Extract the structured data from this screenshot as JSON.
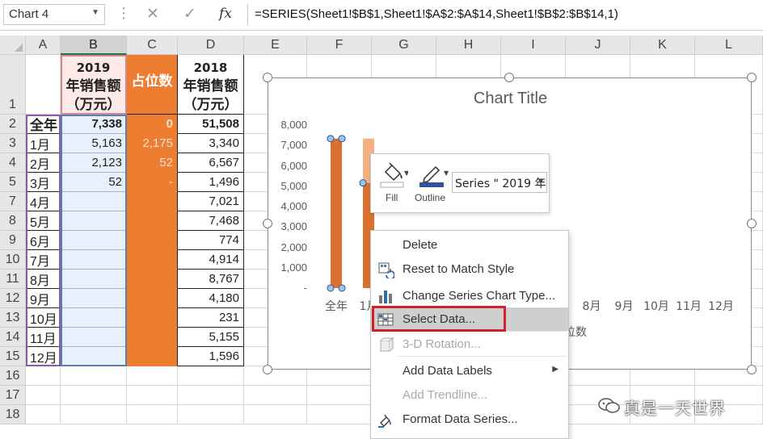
{
  "formula_bar": {
    "name_box": "Chart 4",
    "formula": "=SERIES(Sheet1!$B$1,Sheet1!$A$2:$A$14,Sheet1!$B$2:$B$14,1)",
    "cancel_icon": "close-icon",
    "enter_icon": "check-icon",
    "fx_label": "fx"
  },
  "columns": [
    "A",
    "B",
    "C",
    "D",
    "E",
    "F",
    "G",
    "H",
    "I",
    "J",
    "K",
    "L",
    "M"
  ],
  "rows": [
    "1",
    "2",
    "3",
    "4",
    "5",
    "7",
    "8",
    "9",
    "10",
    "11",
    "12",
    "13",
    "14",
    "15",
    "16",
    "17",
    "18"
  ],
  "table": {
    "headers": {
      "B": [
        "2019",
        "年销售额",
        "（万元）"
      ],
      "C": [
        "占位数"
      ],
      "D": [
        "2018",
        "年销售额",
        "（万元）"
      ]
    },
    "data_rows": [
      {
        "A": "全年",
        "B": "7,338",
        "C": "0",
        "D": "51,508"
      },
      {
        "A": "1月",
        "B": "5,163",
        "C": "2,175",
        "D": "3,340"
      },
      {
        "A": "2月",
        "B": "2,123",
        "C": "52",
        "D": "6,567"
      },
      {
        "A": "3月",
        "B": "52",
        "C": "-",
        "D": "1,496"
      },
      {
        "A": "4月",
        "B": "",
        "C": "",
        "D": "7,021"
      },
      {
        "A": "5月",
        "B": "",
        "C": "",
        "D": "7,468"
      },
      {
        "A": "6月",
        "B": "",
        "C": "",
        "D": "774"
      },
      {
        "A": "7月",
        "B": "",
        "C": "",
        "D": "4,914"
      },
      {
        "A": "8月",
        "B": "",
        "C": "",
        "D": "8,767"
      },
      {
        "A": "9月",
        "B": "",
        "C": "",
        "D": "4,180"
      },
      {
        "A": "10月",
        "B": "",
        "C": "",
        "D": "231"
      },
      {
        "A": "11月",
        "B": "",
        "C": "",
        "D": "5,155"
      },
      {
        "A": "12月",
        "B": "",
        "C": "",
        "D": "1,596"
      }
    ]
  },
  "chart": {
    "title": "Chart Title",
    "y_ticks": [
      "8,000",
      "7,000",
      "6,000",
      "5,000",
      "4,000",
      "3,000",
      "2,000",
      "1,000",
      "-"
    ],
    "x_categories_visible": [
      "全年",
      "1月",
      "8月",
      "9月",
      "10月",
      "11月",
      "12月"
    ],
    "x_axis_fragment": "位数",
    "colors": {
      "series_2019": "#d9702f",
      "series_placeholder": "#f4b183"
    }
  },
  "chart_data": {
    "type": "bar",
    "categories": [
      "全年",
      "1月",
      "2月",
      "3月",
      "4月",
      "5月",
      "6月",
      "7月",
      "8月",
      "9月",
      "10月",
      "11月",
      "12月"
    ],
    "series": [
      {
        "name": "2019年销售额（万元）",
        "values": [
          7338,
          5163,
          2123,
          52,
          null,
          null,
          null,
          null,
          null,
          null,
          null,
          null,
          null
        ]
      },
      {
        "name": "占位数",
        "values": [
          0,
          2175,
          52,
          0,
          null,
          null,
          null,
          null,
          null,
          null,
          null,
          null,
          null
        ]
      }
    ],
    "title": "Chart Title",
    "ylim": [
      0,
      8000
    ]
  },
  "mini_toolbar": {
    "fill_label": "Fill",
    "outline_label": "Outline",
    "series_dropdown": "Series \" 2019 年"
  },
  "context_menu": {
    "items": [
      {
        "label": "Delete",
        "enabled": true
      },
      {
        "label": "Reset to Match Style",
        "enabled": true
      },
      {
        "label": "Change Series Chart Type...",
        "enabled": true
      },
      {
        "label": "Select Data...",
        "enabled": true
      },
      {
        "label": "3-D Rotation...",
        "enabled": false
      },
      {
        "label": "Add Data Labels",
        "enabled": true
      },
      {
        "label": "Add Trendline...",
        "enabled": false
      },
      {
        "label": "Format Data Series...",
        "enabled": true
      }
    ]
  },
  "watermark": "真是一天世界"
}
